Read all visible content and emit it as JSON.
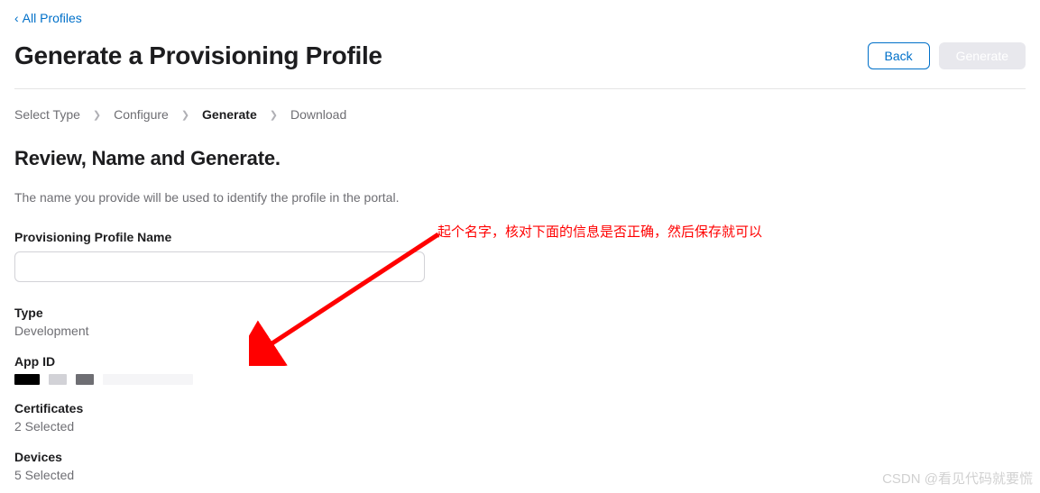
{
  "nav": {
    "back_label": "All Profiles"
  },
  "header": {
    "title": "Generate a Provisioning Profile",
    "back_btn": "Back",
    "generate_btn": "Generate"
  },
  "breadcrumb": {
    "steps": [
      "Select Type",
      "Configure",
      "Generate",
      "Download"
    ],
    "current_index": 2
  },
  "section": {
    "title": "Review, Name and Generate.",
    "subtitle": "The name you provide will be used to identify the profile in the portal."
  },
  "form": {
    "name_label": "Provisioning Profile Name",
    "name_value": ""
  },
  "summary": {
    "type_label": "Type",
    "type_value": "Development",
    "appid_label": "App ID",
    "certs_label": "Certificates",
    "certs_value": "2 Selected",
    "devices_label": "Devices",
    "devices_value": "5 Selected"
  },
  "annotation": {
    "text": "起个名字，核对下面的信息是否正确，然后保存就可以"
  },
  "watermark": "CSDN @看见代码就要慌"
}
